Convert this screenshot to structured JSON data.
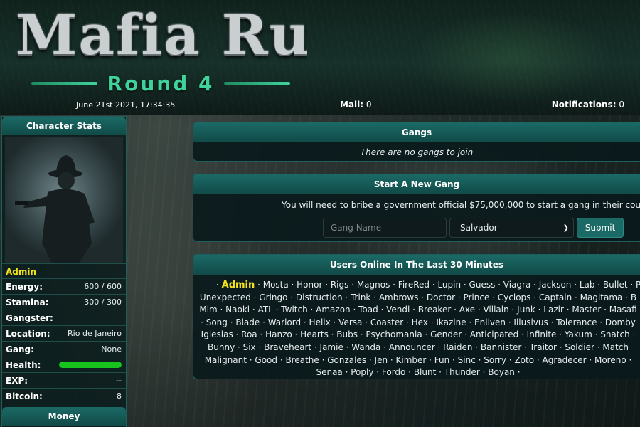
{
  "header": {
    "logo_title": "Mafia Rules",
    "logo_subtitle": "Round 4",
    "date": "June 21st 2021, 17:34:35",
    "mail_label": "Mail:",
    "mail_count": "0",
    "notifications_label": "Notifications:",
    "notifications_count": "0"
  },
  "sidebar": {
    "title": "Character Stats",
    "username": "Admin",
    "stats": {
      "energy_label": "Energy:",
      "energy_value": "600 / 600",
      "stamina_label": "Stamina:",
      "stamina_value": "300 / 300",
      "gangster_label": "Gangster:",
      "gangster_value": "",
      "location_label": "Location:",
      "location_value": "Rio de Janeiro",
      "gang_label": "Gang:",
      "gang_value": "None",
      "health_label": "Health:",
      "health_percent": 100,
      "exp_label": "EXP:",
      "exp_value": "--",
      "bitcoin_label": "Bitcoin:",
      "bitcoin_value": "8"
    },
    "money_title": "Money"
  },
  "gangs": {
    "title": "Gangs",
    "empty_message": "There are no gangs to join"
  },
  "new_gang": {
    "title": "Start A New Gang",
    "message": "You will need to bribe a government official $75,000,000 to start a gang in their cou",
    "name_placeholder": "Gang Name",
    "location_selected": "Salvador",
    "submit_label": "Submit"
  },
  "online": {
    "title": "Users Online In The Last 30 Minutes",
    "current_user": "Admin",
    "lines": [
      " · Mosta · Honor · Rigs · Magnos · FireRed · Lupin · Guess · Viagra · Jackson · Lab · Bullet · P",
      "Unexpected · Gringo · Distruction · Trink · Ambrows · Doctor · Prince · Cyclops · Captain · Magitama · B",
      "Mim · Naoki · ATL · Twitch · Amazon · Toad · Vendi · Breaker · Axe · Villain · Junk · Lazir · Master · Masafi",
      " · Song · Blade · Warlord · Helix · Versa · Coaster · Hex · Ikazine · Enliven · Illusivus · Tolerance · Domby",
      "Iglesias · Roa · Hanzo · Hearts · Bubs · Psychomania · Gender · Anticipated · Infinite · Yakum · Snatch · ",
      "Bunny · Six · Braveheart · Jamie · Wanda · Announcer · Raiden · Bannister · Traitor · Soldier · Match",
      "Malignant · Good · Breathe · Gonzales · Jen · Kimber · Fun · Sinc · Sorry · Zoto · Agradecer · Moreno · ",
      "Senaa · Poply · Fordo · Blunt · Thunder · Boyan · "
    ]
  }
}
